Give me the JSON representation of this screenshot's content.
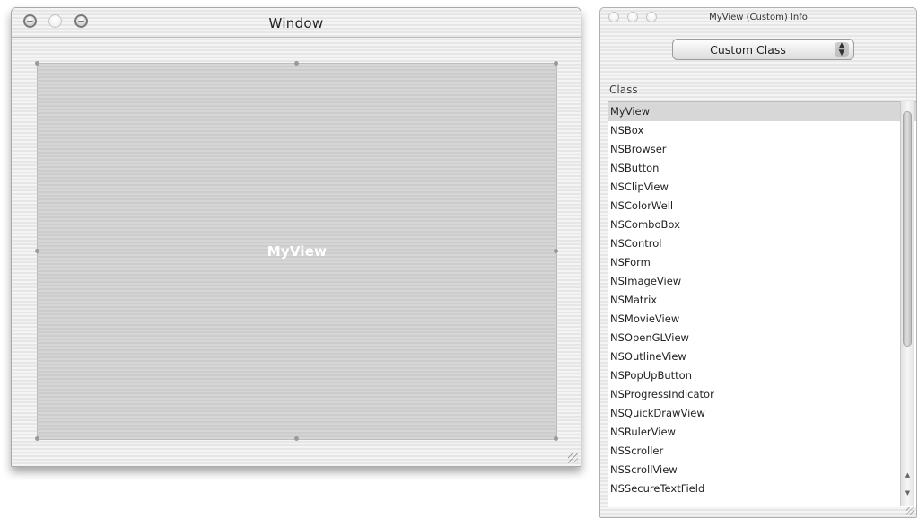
{
  "main_window": {
    "title": "Window",
    "custom_view_label": "MyView"
  },
  "info_panel": {
    "title": "MyView (Custom) Info",
    "popup_selected": "Custom Class",
    "class_header": "Class",
    "selected_class": "MyView",
    "classes": [
      "MyView",
      "NSBox",
      "NSBrowser",
      "NSButton",
      "NSClipView",
      "NSColorWell",
      "NSComboBox",
      "NSControl",
      "NSForm",
      "NSImageView",
      "NSMatrix",
      "NSMovieView",
      "NSOpenGLView",
      "NSOutlineView",
      "NSPopUpButton",
      "NSProgressIndicator",
      "NSQuickDrawView",
      "NSRulerView",
      "NSScroller",
      "NSScrollView",
      "NSSecureTextField"
    ]
  },
  "colors": {
    "selection": "#d7d7d7",
    "view_fill": "#d2d2d2",
    "view_label": "#ffffff"
  },
  "icons": {
    "close": "close-button-icon",
    "minimize": "minimize-button-icon",
    "zoom": "zoom-button-icon",
    "popup_arrows": "up-down-arrows-icon",
    "resize": "resize-grip-icon"
  }
}
